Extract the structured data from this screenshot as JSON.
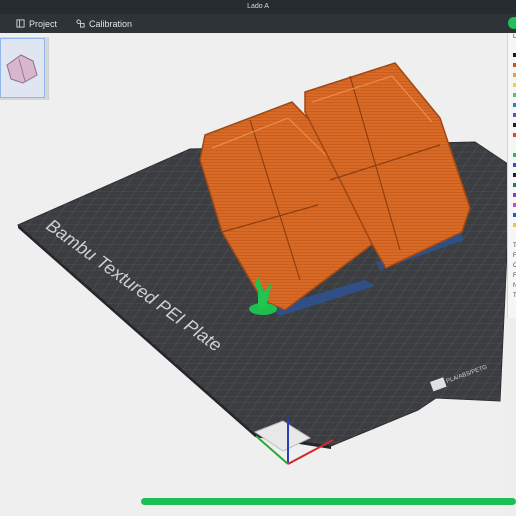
{
  "window": {
    "title": "Lado A"
  },
  "menubar": {
    "items": [
      {
        "label": "Project",
        "icon": "project-icon"
      },
      {
        "label": "Calibration",
        "icon": "calibration-icon"
      }
    ]
  },
  "plate": {
    "name": "Bambu Textured PEI Plate",
    "badge": "PLA/ABS/PETG"
  },
  "colors": {
    "accent": "#20c15a",
    "model": "#d86a24",
    "support": "#2f4f86",
    "plate": "#3b3d40"
  },
  "progress": {
    "fraction": 1.0
  },
  "rightbar": {
    "label_top": "L",
    "labels": [
      "T",
      "F",
      "C",
      "F",
      "N",
      "T"
    ]
  }
}
